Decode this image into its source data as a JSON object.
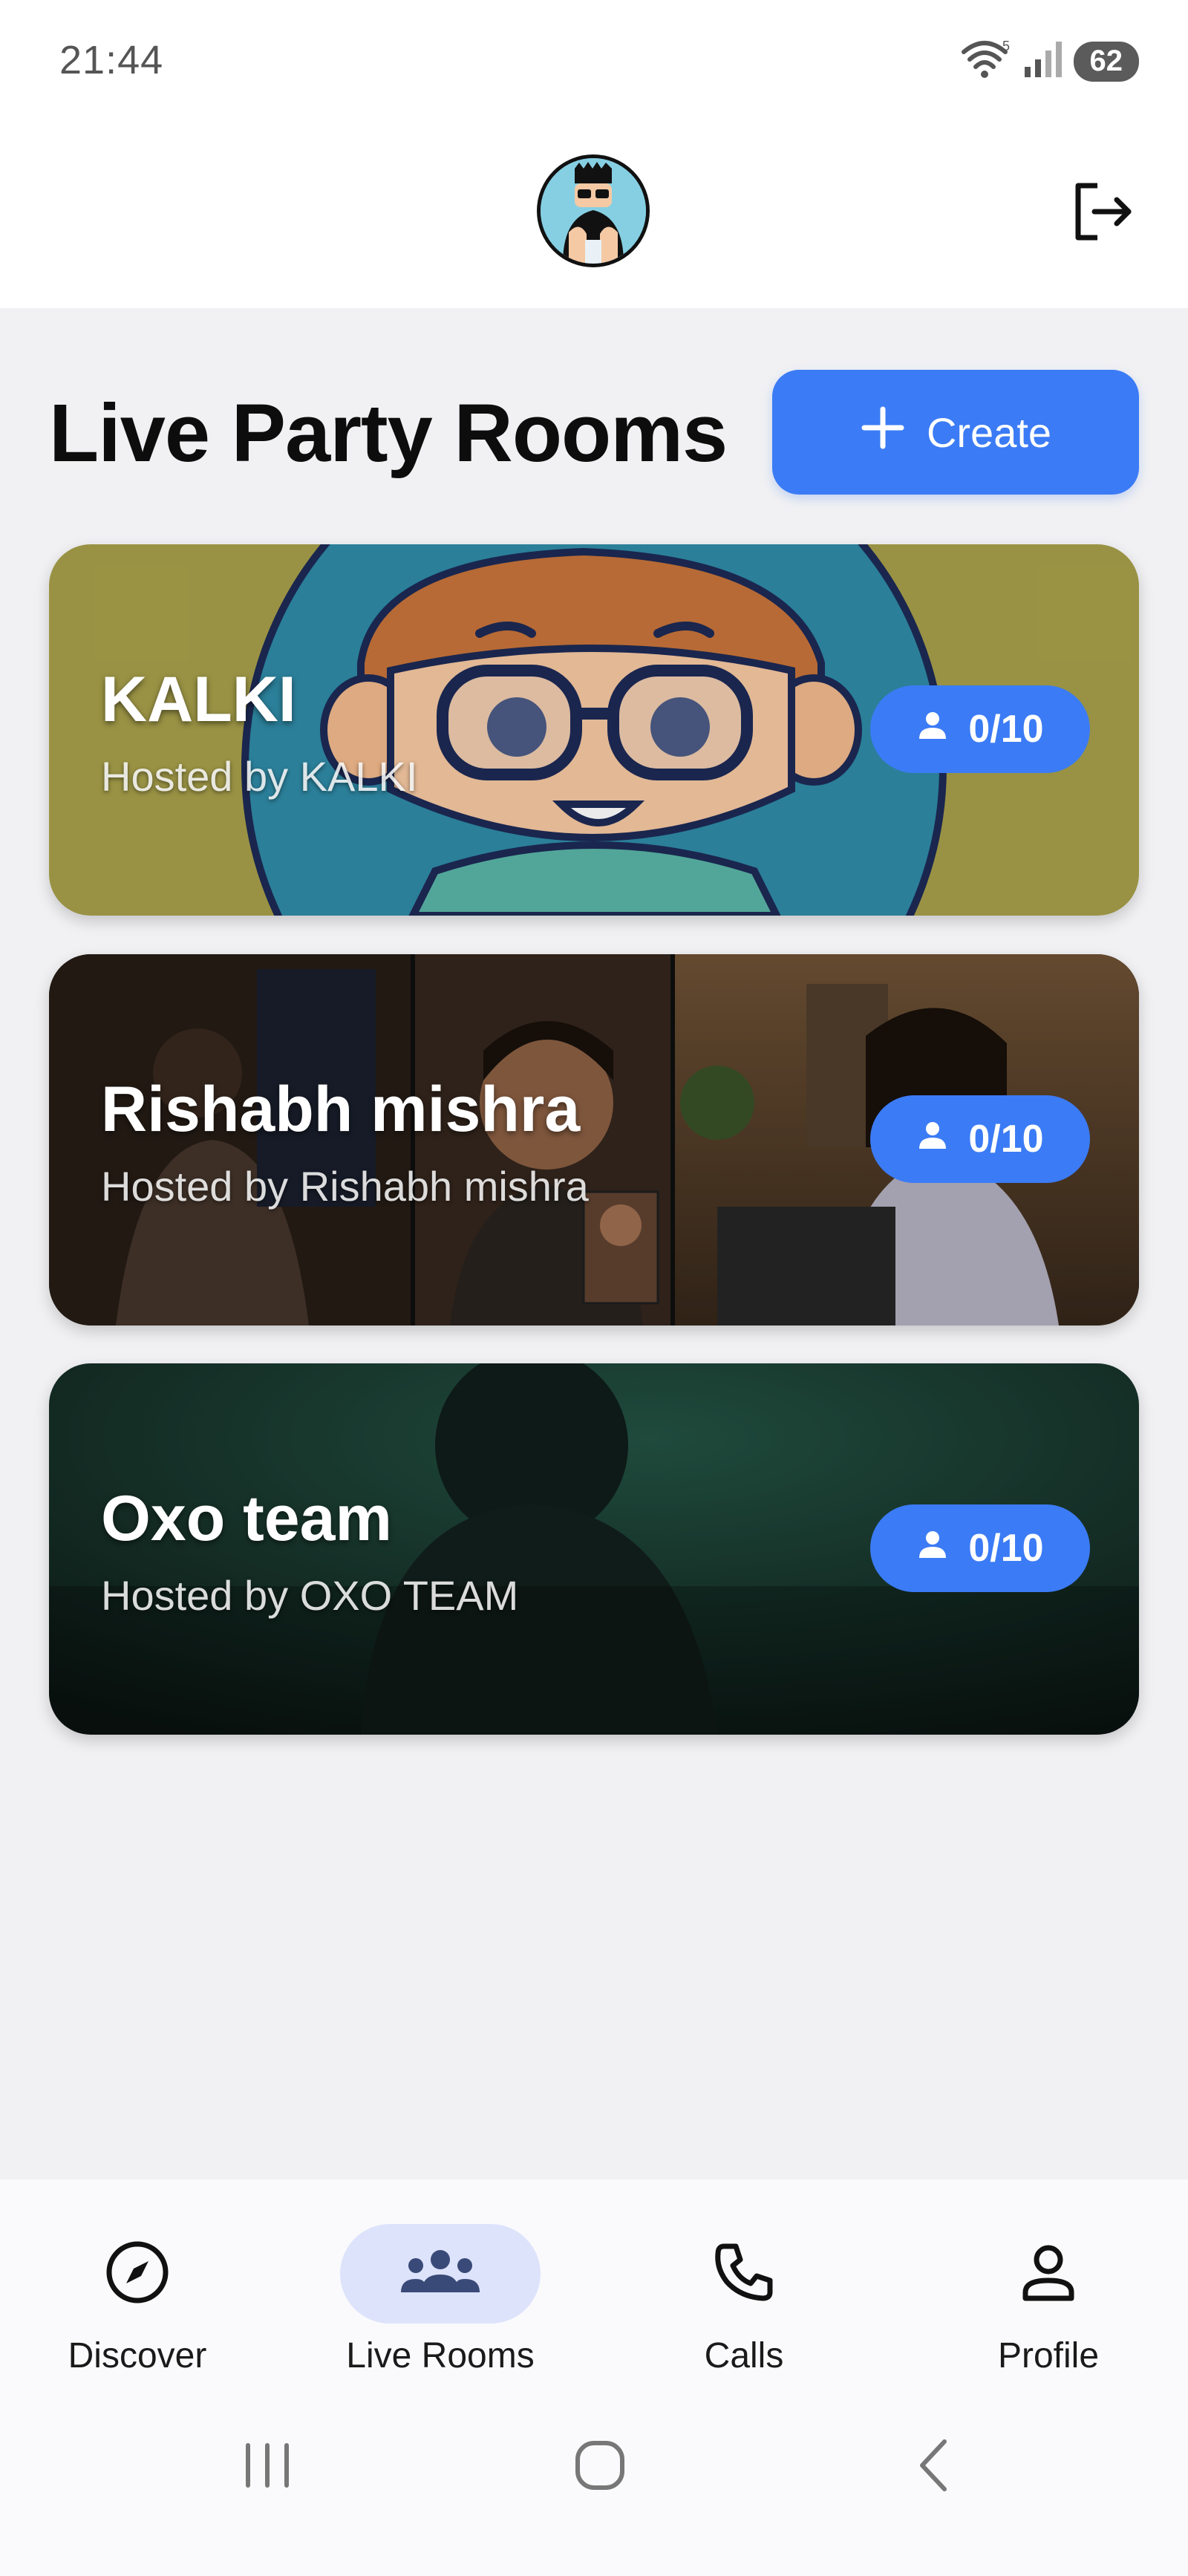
{
  "status_bar": {
    "time": "21:44",
    "battery": "62",
    "wifi_icon": "wifi-icon",
    "signal_icon": "signal-icon"
  },
  "header": {
    "avatar_icon": "user-avatar",
    "logout_icon": "logout-icon"
  },
  "section": {
    "title": "Live Party Rooms",
    "create_label": "Create"
  },
  "rooms": [
    {
      "name": "KALKI",
      "host": "Hosted by KALKI",
      "count": "0/10"
    },
    {
      "name": "Rishabh mishra",
      "host": "Hosted by Rishabh mishra",
      "count": "0/10"
    },
    {
      "name": "Oxo team",
      "host": "Hosted by OXO TEAM",
      "count": "0/10"
    }
  ],
  "bottom_nav": {
    "items": [
      {
        "label": "Discover",
        "icon": "compass-icon"
      },
      {
        "label": "Live Rooms",
        "icon": "group-icon",
        "active": true
      },
      {
        "label": "Calls",
        "icon": "phone-icon"
      },
      {
        "label": "Profile",
        "icon": "person-icon"
      }
    ]
  },
  "system_nav": [
    "recents-icon",
    "home-icon",
    "back-icon"
  ],
  "colors": {
    "accent": "#3b7bf5",
    "background": "#f1f1f3",
    "active_nav_bg": "#dde3fb"
  }
}
